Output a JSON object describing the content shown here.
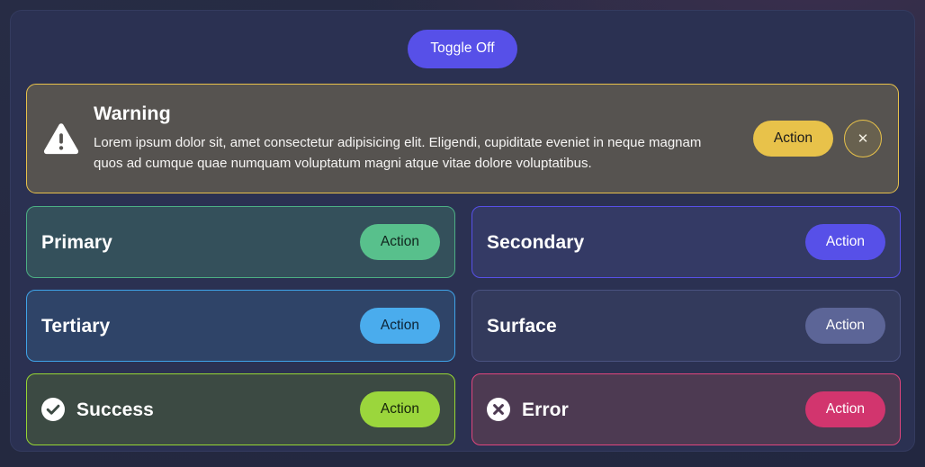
{
  "theme": {
    "page_background": "#262b44",
    "panel_background": "#2b3152",
    "accent_indigo": "#5750e8",
    "accent_warning": "#e8c24a",
    "accent_success": "#9bd63c",
    "accent_error": "#d2356e",
    "accent_primary": "#58c08c",
    "accent_tertiary": "#4aaced",
    "accent_surface": "#5c6597"
  },
  "toggle": {
    "label": "Toggle Off",
    "icon": "none"
  },
  "alert": {
    "severity": "warning",
    "icon": "warning-triangle-icon",
    "title": "Warning",
    "message": "Lorem ipsum dolor sit, amet consectetur adipisicing elit. Eligendi, cupiditate eveniet in neque magnam quos ad cumque quae numquam voluptatum magni atque vitae dolore voluptatibus.",
    "action_label": "Action",
    "close_icon": "close-x-icon",
    "close_glyph": "✕"
  },
  "cards": [
    {
      "id": "primary",
      "title": "Primary",
      "action_label": "Action",
      "icon": null,
      "background": "#34505b",
      "border": "#4caf84",
      "button_background": "#58c08c",
      "button_text_color": "#10251d"
    },
    {
      "id": "secondary",
      "title": "Secondary",
      "action_label": "Action",
      "icon": null,
      "background": "#343a65",
      "border": "#5750e8",
      "button_background": "#5750e8",
      "button_text_color": "#ffffff"
    },
    {
      "id": "tertiary",
      "title": "Tertiary",
      "action_label": "Action",
      "icon": null,
      "background": "#2f4468",
      "border": "#3fa3e8",
      "button_background": "#4aaced",
      "button_text_color": "#0d2335"
    },
    {
      "id": "surface",
      "title": "Surface",
      "action_label": "Action",
      "icon": null,
      "background": "#333a5c",
      "border": "#4a5280",
      "button_background": "#5c6597",
      "button_text_color": "#ffffff"
    },
    {
      "id": "success",
      "title": "Success",
      "action_label": "Action",
      "icon": "check-circle-icon",
      "background": "#3c4a43",
      "border": "#96d633",
      "button_background": "#9bd63c",
      "button_text_color": "#16240a"
    },
    {
      "id": "error",
      "title": "Error",
      "action_label": "Action",
      "icon": "x-circle-icon",
      "background": "#4d3a52",
      "border": "#e0457d",
      "button_background": "#d2356e",
      "button_text_color": "#ffffff"
    }
  ]
}
